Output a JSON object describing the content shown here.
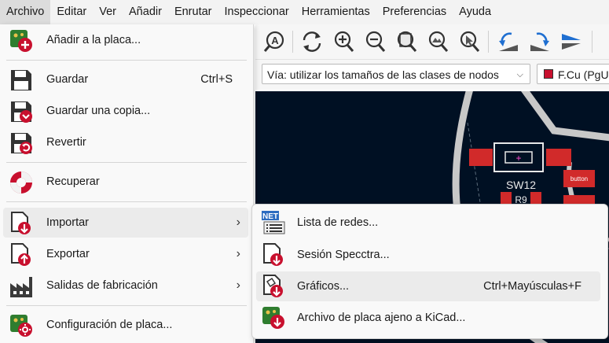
{
  "menubar": {
    "items": [
      "Archivo",
      "Editar",
      "Ver",
      "Añadir",
      "Enrutar",
      "Inspeccionar",
      "Herramientas",
      "Preferencias",
      "Ayuda"
    ]
  },
  "toolbar": {
    "via_combo": "Vía: utilizar los tamaños de las clases de nodos",
    "layer_combo": "F.Cu (PgU",
    "layer_color": "#c8102e"
  },
  "file_menu": {
    "items": [
      {
        "label": "Añadir a la placa...",
        "icon": "board-add-icon"
      },
      {
        "label": "Guardar",
        "shortcut": "Ctrl+S",
        "icon": "save-icon"
      },
      {
        "label": "Guardar una copia...",
        "icon": "save-copy-icon"
      },
      {
        "label": "Revertir",
        "icon": "revert-icon"
      },
      {
        "label": "Recuperar",
        "icon": "rescue-icon"
      },
      {
        "label": "Importar",
        "icon": "import-icon",
        "submenu": true
      },
      {
        "label": "Exportar",
        "icon": "export-icon",
        "submenu": true
      },
      {
        "label": "Salidas de fabricación",
        "icon": "factory-icon",
        "submenu": true
      },
      {
        "label": "Configuración de placa...",
        "icon": "board-setup-icon"
      }
    ],
    "submenu_chevron": "›"
  },
  "import_submenu": {
    "items": [
      {
        "label": "Lista de redes...",
        "icon": "netlist-icon",
        "badge": "NET"
      },
      {
        "label": "Sesión Specctra...",
        "icon": "specctra-import-icon"
      },
      {
        "label": "Gráficos...",
        "shortcut": "Ctrl+Mayúsculas+F",
        "icon": "graphics-import-icon"
      },
      {
        "label": "Archivo de placa ajeno a KiCad...",
        "icon": "non-kicad-board-icon"
      }
    ]
  },
  "canvas": {
    "labels": [
      "SW12",
      "R9",
      "button"
    ]
  },
  "colors": {
    "accent_red": "#c8102e",
    "board_bg": "#001023",
    "pad_red": "#d12a2a",
    "highlight": "#ebebeb"
  }
}
